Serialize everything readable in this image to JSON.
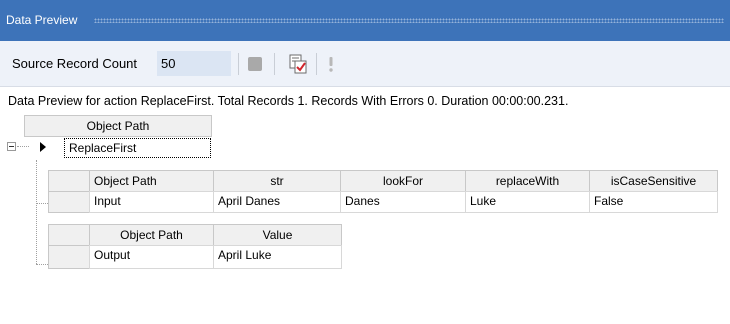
{
  "window": {
    "title": "Data Preview"
  },
  "toolbar": {
    "source_label": "Source Record Count",
    "source_value": "50",
    "stop_icon": "stop-icon",
    "preview_icon": "preview-checklist-icon",
    "alert_icon": "exclamation-icon"
  },
  "status": "Data Preview for action ReplaceFirst. Total Records 1. Records With Errors 0. Duration 00:00:00.231.",
  "tree": {
    "header": "Object Path",
    "root": "ReplaceFirst",
    "input_table": {
      "columns": [
        "Object Path",
        "str",
        "lookFor",
        "replaceWith",
        "isCaseSensitive"
      ],
      "rows": [
        [
          "Input",
          "April Danes",
          "Danes",
          "Luke",
          "False"
        ]
      ]
    },
    "output_table": {
      "columns": [
        "Object Path",
        "Value"
      ],
      "rows": [
        [
          "Output",
          "April Luke"
        ]
      ]
    }
  },
  "colors": {
    "titlebar": "#3d73b9",
    "toolbar": "#eef2f9",
    "input_bg": "#dbe5f3"
  }
}
